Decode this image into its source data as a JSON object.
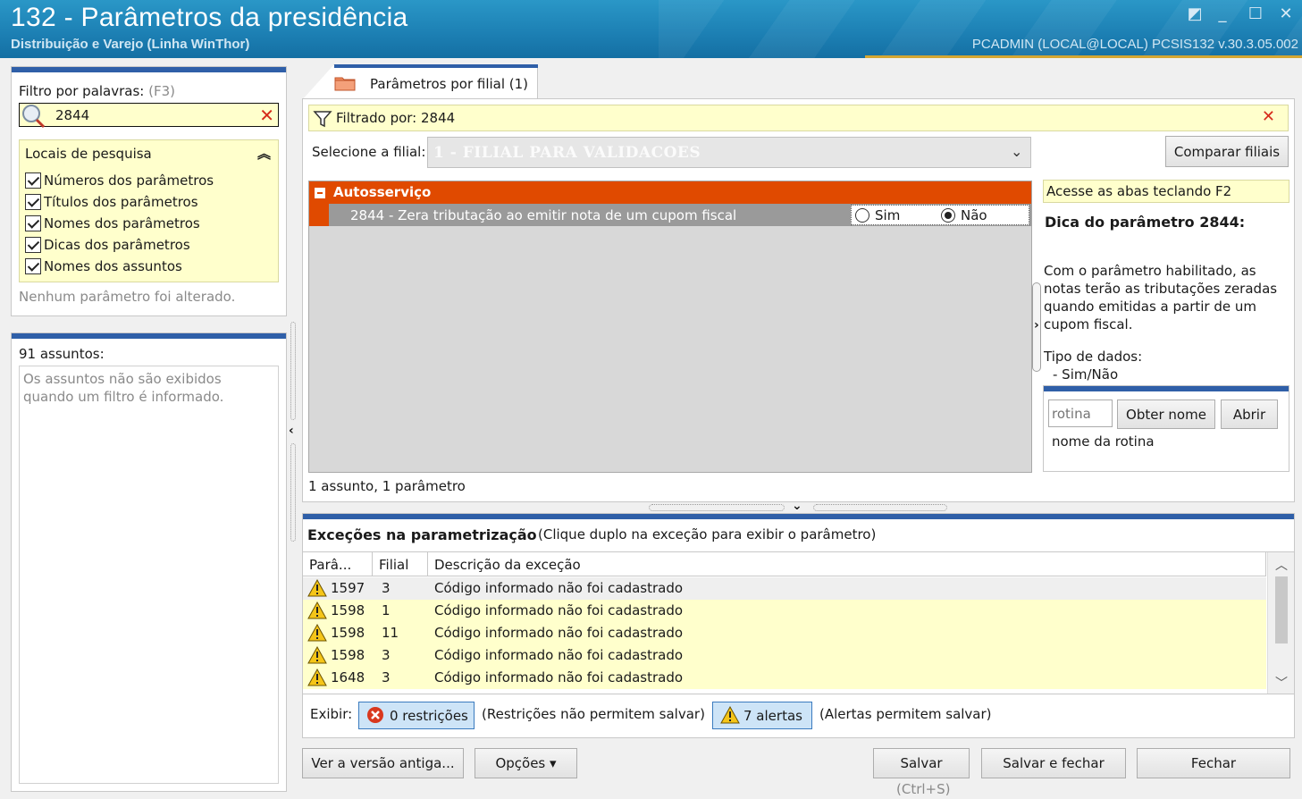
{
  "window": {
    "title": "132 - Parâmetros da presidência",
    "subtitle": "Distribuição e Varejo (Linha WinThor)",
    "user_info": "PCADMIN (LOCAL@LOCAL)   PCSIS132  v.30.3.05.002"
  },
  "filter": {
    "label": "Filtro por palavras:",
    "hint": "(F3)",
    "value": "2844",
    "locais_title": "Locais de pesquisa",
    "options": [
      "Números dos parâmetros",
      "Títulos dos parâmetros",
      "Nomes dos parâmetros",
      "Dicas dos parâmetros",
      "Nomes dos assuntos"
    ],
    "status": "Nenhum parâmetro foi alterado."
  },
  "assuntos": {
    "count": "91 assuntos:",
    "message": "Os assuntos não são exibidos quando um filtro é informado."
  },
  "tab": {
    "label": "Parâmetros por filial  (1)"
  },
  "main": {
    "filtrado": "Filtrado por: 2844",
    "filial_label": "Selecione a filial:",
    "filial_value": "1 - FILIAL PARA VALIDACOES",
    "comparar_label": "Comparar filiais",
    "group_title": "Autosserviço",
    "param_text": "2844 - Zera tributação ao emitir nota de um cupom fiscal",
    "radio_sim": "Sim",
    "radio_nao": "Não",
    "selected": "Não",
    "status_count": "1 assunto,  1 parâmetro"
  },
  "info": {
    "acesse": "Acesse as abas teclando F2",
    "dica_title": "Dica do parâmetro 2844:",
    "dica_text": "Com o parâmetro habilitado, as notas terão as tributações zeradas quando emitidas a partir de um cupom fiscal.",
    "tipo_title": "Tipo de dados:",
    "tipo_value": "- Sim/Não",
    "rotina_placeholder": "rotina",
    "obter_label": "Obter nome",
    "abrir_label": "Abrir",
    "nome_rotina": "nome da rotina"
  },
  "exceptions": {
    "title": "Exceções na parametrização",
    "hint": "(Clique duplo na exceção para exibir o parâmetro)",
    "columns": [
      "Parâ...",
      "Filial",
      "Descrição da exceção"
    ],
    "rows": [
      {
        "param": "1597",
        "filial": "3",
        "desc": "Código informado não foi cadastrado"
      },
      {
        "param": "1598",
        "filial": "1",
        "desc": "Código informado não foi cadastrado"
      },
      {
        "param": "1598",
        "filial": "11",
        "desc": "Código informado não foi cadastrado"
      },
      {
        "param": "1598",
        "filial": "3",
        "desc": "Código informado não foi cadastrado"
      },
      {
        "param": "1648",
        "filial": "3",
        "desc": "Código informado não foi cadastrado"
      }
    ],
    "exibir_label": "Exibir:",
    "restricoes_label": "0 restrições",
    "restricoes_hint": "(Restrições não permitem salvar)",
    "alertas_label": "7 alertas",
    "alertas_hint": "(Alertas permitem salvar)"
  },
  "buttons": {
    "versao": "Ver a versão antiga...",
    "opcoes": "Opções ▾",
    "salvar": "Salvar",
    "salvar_fechar": "Salvar e fechar",
    "fechar": "Fechar",
    "shortcut": "(Ctrl+S)"
  },
  "colors": {
    "accent_orange": "#e04a00",
    "highlight_yellow": "#ffffcc",
    "panel_blue": "#2f5fa8",
    "titlebar_blue": "#1c7fb3"
  }
}
